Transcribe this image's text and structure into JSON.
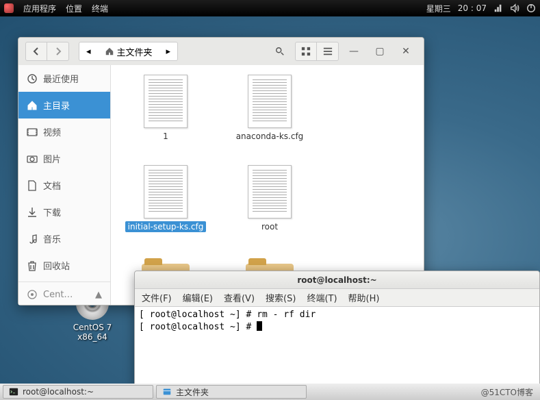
{
  "top_panel": {
    "applications": "应用程序",
    "places": "位置",
    "terminal": "终端",
    "day": "星期三",
    "time": "20 : 07"
  },
  "desktop": {
    "disc_label": "CentOS 7 x86_64"
  },
  "filemgr": {
    "path_label": "主文件夹",
    "sidebar": {
      "recent": "最近使用",
      "home": "主目录",
      "video": "视频",
      "pictures": "图片",
      "documents": "文档",
      "downloads": "下载",
      "music": "音乐",
      "trash": "回收站",
      "device": "Cent…"
    },
    "files": [
      {
        "name": "1",
        "kind": "doc",
        "selected": false
      },
      {
        "name": "anaconda-ks.cfg",
        "kind": "doc",
        "selected": false
      },
      {
        "name": "initial-setup-ks.cfg",
        "kind": "doc",
        "selected": true
      },
      {
        "name": "root",
        "kind": "doc",
        "selected": false
      },
      {
        "name": "",
        "kind": "folder",
        "selected": false
      },
      {
        "name": "",
        "kind": "folder",
        "selected": false
      }
    ]
  },
  "terminal": {
    "title": "root@localhost:~",
    "menu": {
      "file": "文件(F)",
      "edit": "编辑(E)",
      "view": "查看(V)",
      "search": "搜索(S)",
      "terminal": "终端(T)",
      "help": "帮助(H)"
    },
    "line1_prompt": "[ root@localhost ~] # ",
    "line1_cmd": "rm - rf dir",
    "line2_prompt": "[ root@localhost ~] # "
  },
  "bottom": {
    "task1": "root@localhost:~",
    "task2": "主文件夹",
    "watermark": "@51CTO博客"
  }
}
